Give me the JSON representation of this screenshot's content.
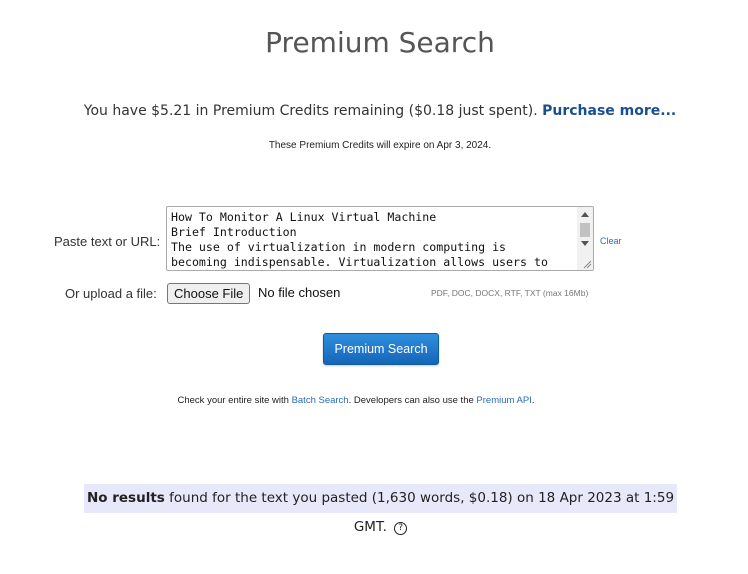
{
  "page": {
    "title": "Premium Search"
  },
  "credits": {
    "text": "You have $5.21 in Premium Credits remaining ($0.18 just spent).",
    "purchase_link": "Purchase more...",
    "expiry": "These Premium Credits will expire on Apr 3, 2024."
  },
  "form": {
    "paste_label": "Paste text or URL:",
    "textarea_value": "How To Monitor A Linux Virtual Machine\nBrief Introduction\nThe use of virtualization in modern computing is\nbecoming indispensable. Virtualization allows users to",
    "clear_label": "Clear",
    "upload_label": "Or upload a file:",
    "choose_file_label": "Choose File",
    "no_file_text": "No file chosen",
    "formats_hint": "PDF, DOC, DOCX, RTF, TXT (max 16Mb)",
    "search_button": "Premium Search"
  },
  "footer_line": {
    "prefix": "Check your entire site with",
    "batch_link": "Batch Search",
    "middle": ". Developers can also use the",
    "api_link": "Premium API",
    "suffix": "."
  },
  "results": {
    "bold": "No results",
    "text": "found for the text you pasted (1,630 words, $0.18) on 18 Apr 2023 at 1:59 GMT.",
    "help_icon": "?"
  }
}
